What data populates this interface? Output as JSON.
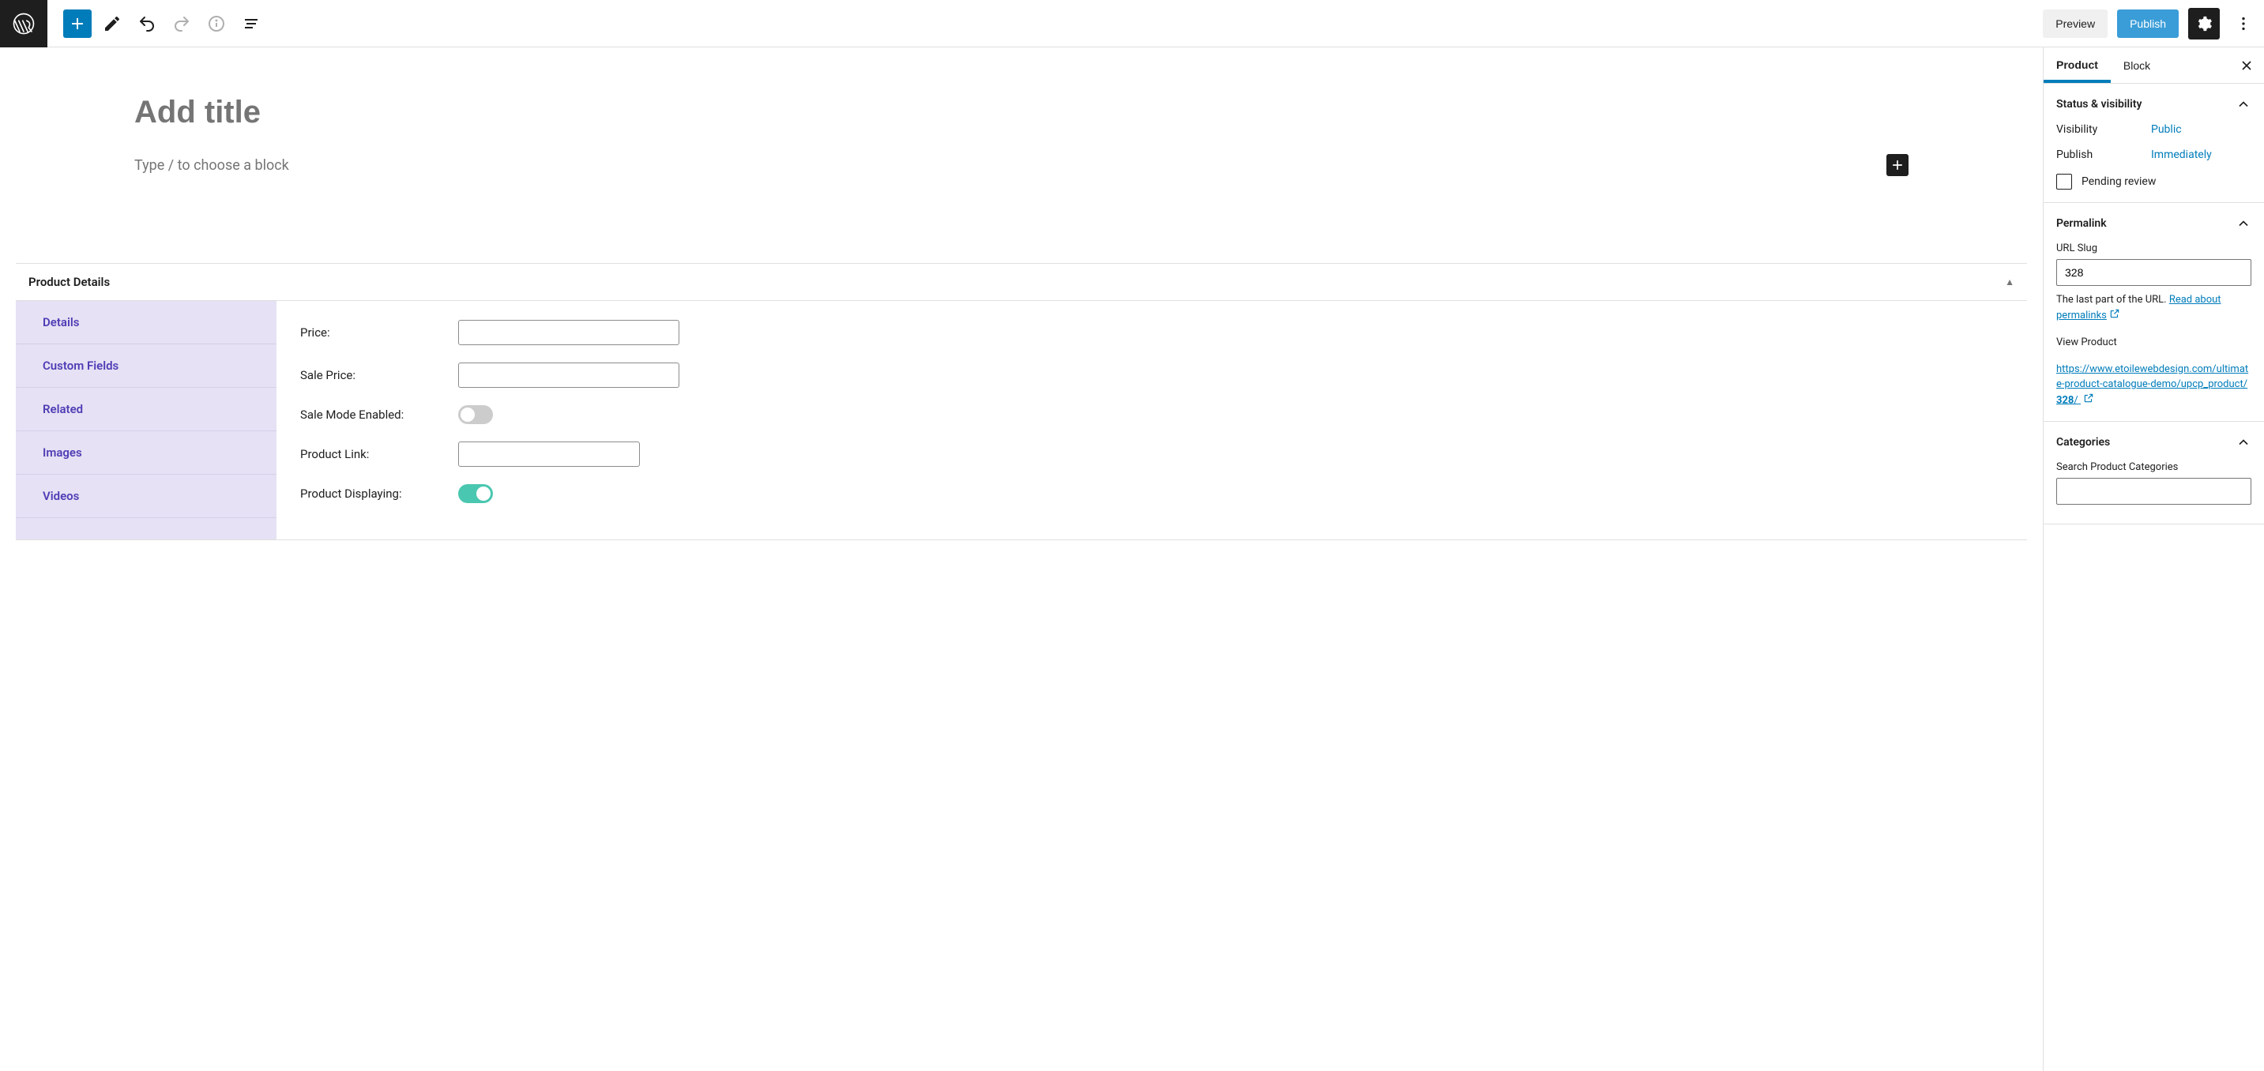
{
  "toolbar": {
    "preview_label": "Preview",
    "publish_label": "Publish"
  },
  "editor": {
    "title_placeholder": "Add title",
    "block_prompt": "Type / to choose a block"
  },
  "product_details": {
    "title": "Product Details",
    "tabs": [
      "Details",
      "Custom Fields",
      "Related",
      "Images",
      "Videos"
    ],
    "fields": {
      "price_label": "Price:",
      "sale_price_label": "Sale Price:",
      "sale_mode_label": "Sale Mode Enabled:",
      "product_link_label": "Product Link:",
      "product_displaying_label": "Product Displaying:"
    }
  },
  "sidebar": {
    "tabs": {
      "product": "Product",
      "block": "Block"
    },
    "status": {
      "title": "Status & visibility",
      "visibility_label": "Visibility",
      "visibility_value": "Public",
      "publish_label": "Publish",
      "publish_value": "Immediately",
      "pending_review": "Pending review"
    },
    "permalink": {
      "title": "Permalink",
      "slug_label": "URL Slug",
      "slug_value": "328",
      "help_prefix": "The last part of the URL. ",
      "help_link": "Read about permalinks",
      "view_label": "View Product",
      "url_part1": "https://www.etoilewebdesign.com/ultimate-product-catalogue-demo/upcp_product/",
      "url_part2": "328",
      "url_part3": "/"
    },
    "categories": {
      "title": "Categories",
      "search_label": "Search Product Categories"
    }
  }
}
